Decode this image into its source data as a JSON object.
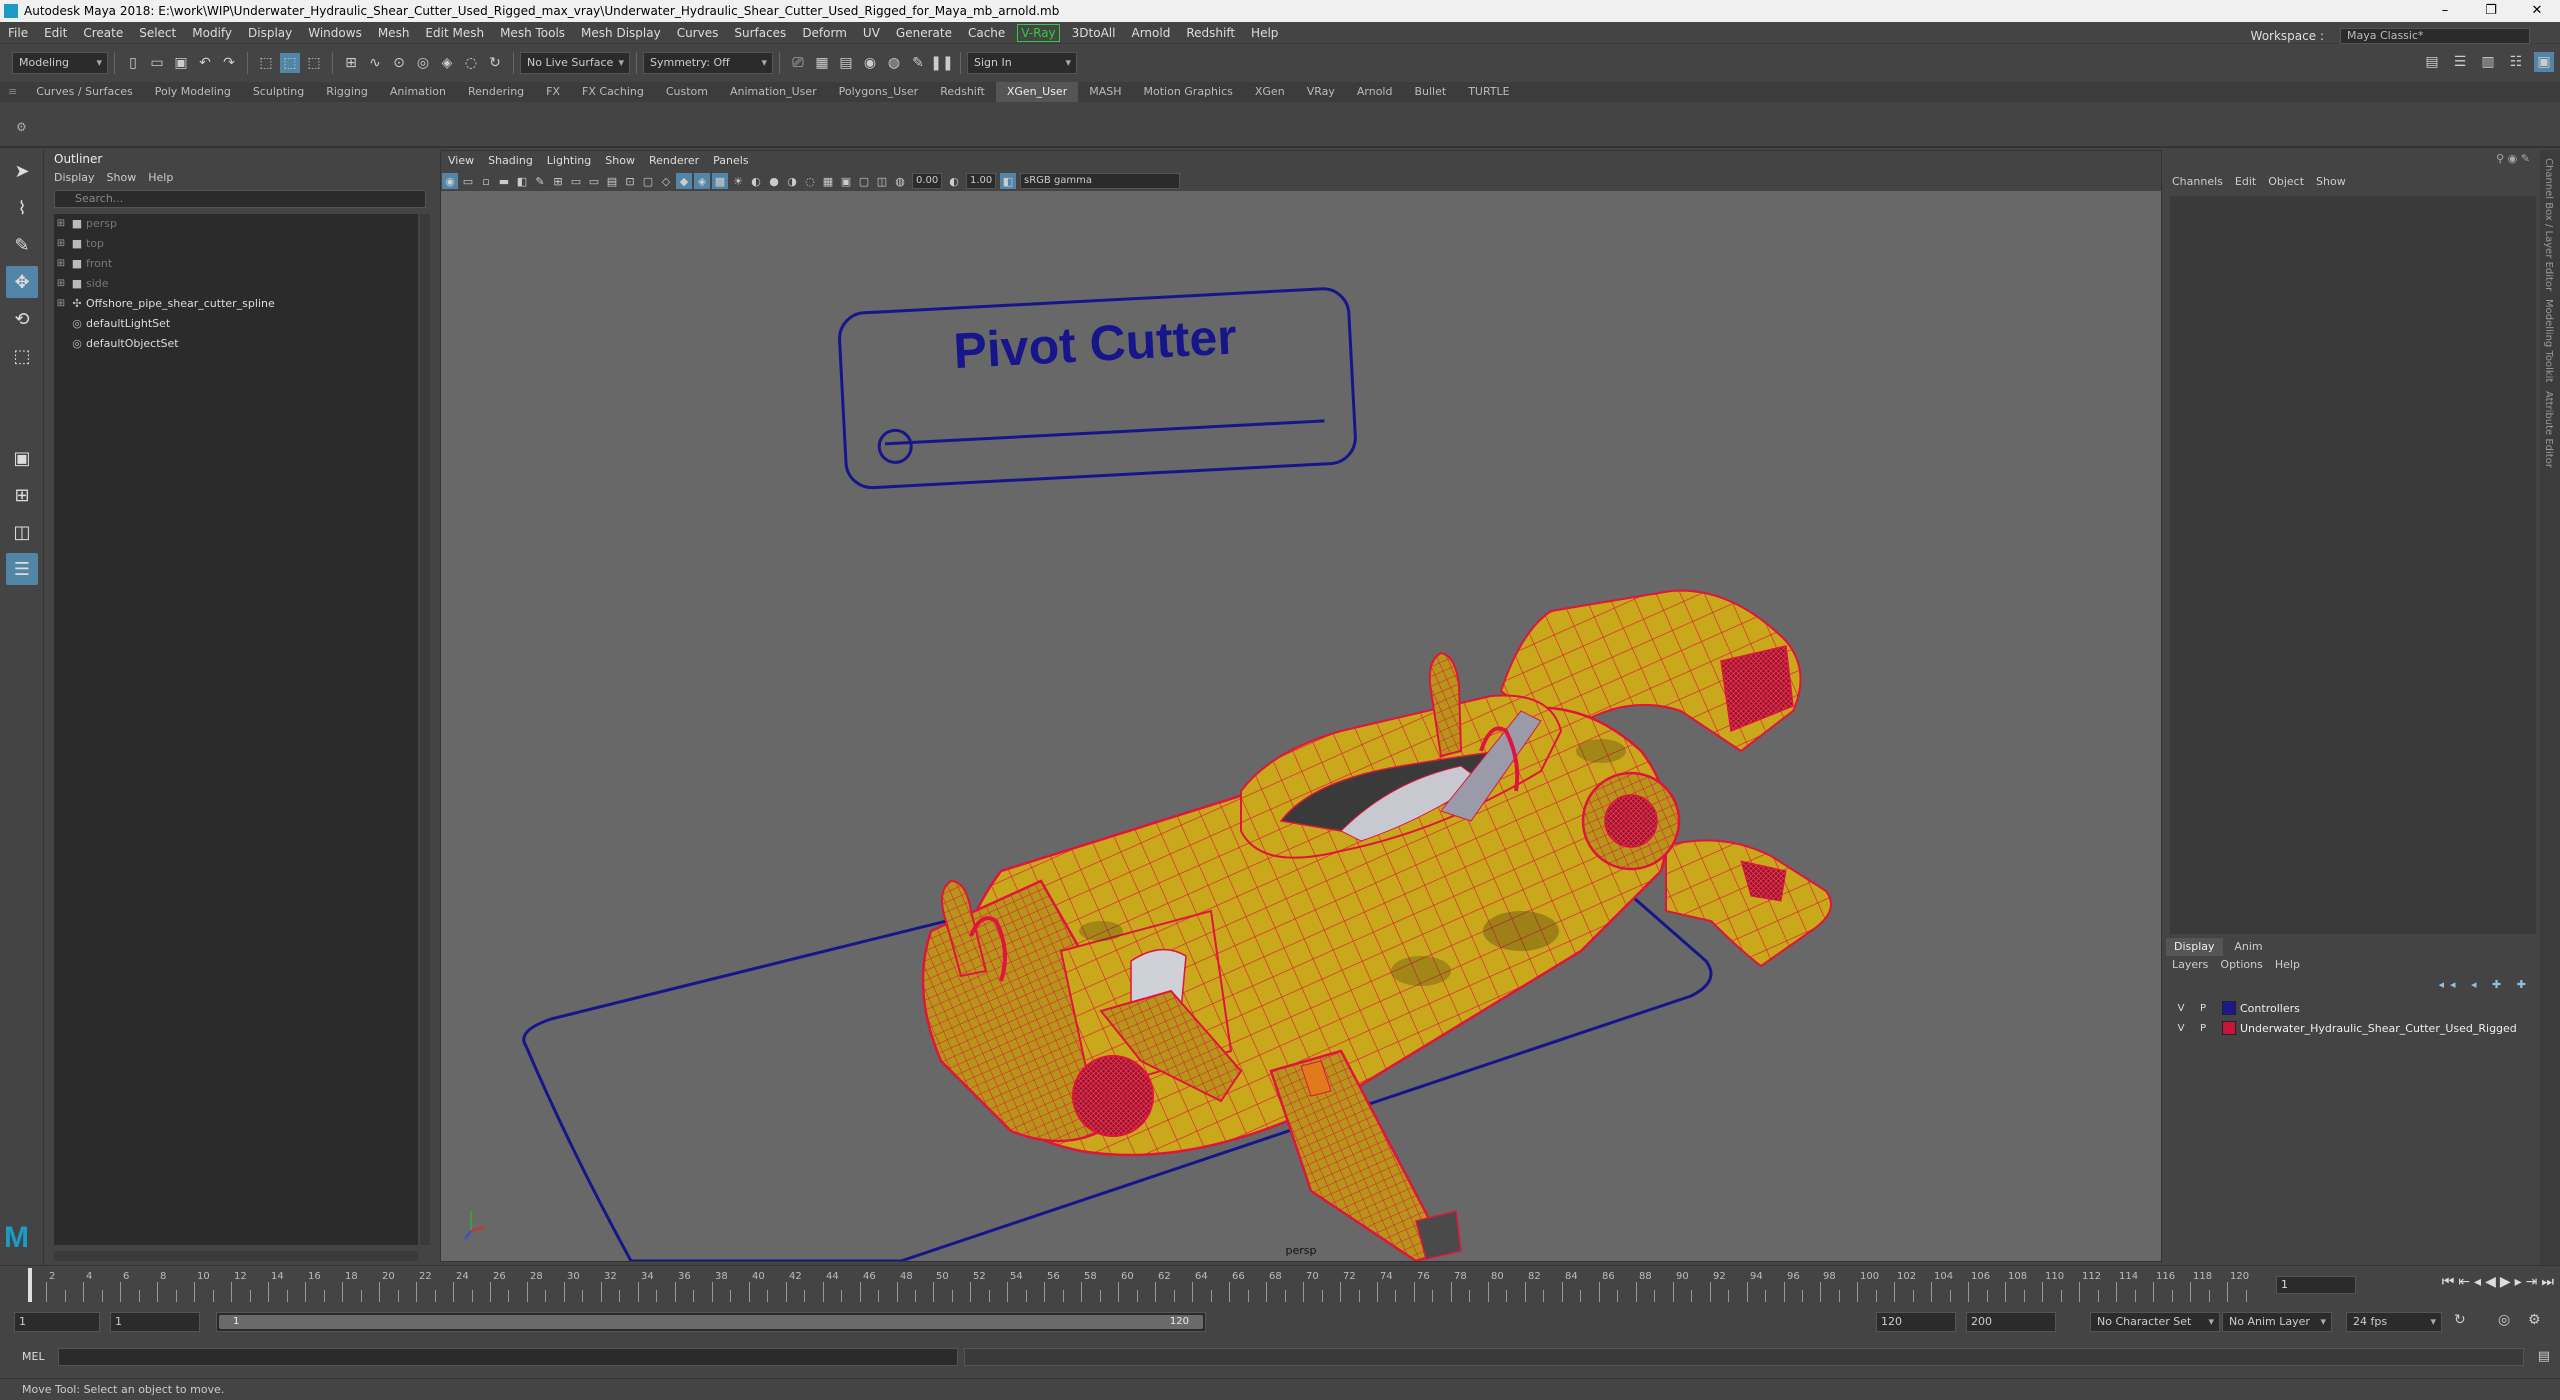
{
  "app": {
    "title": "Autodesk Maya 2018: E:\\work\\WIP\\Underwater_Hydraulic_Shear_Cutter_Used_Rigged_max_vray\\Underwater_Hydraulic_Shear_Cutter_Used_Rigged_for_Maya_mb_arnold.mb",
    "window_controls": [
      "–",
      "❐",
      "✕"
    ]
  },
  "menubar": {
    "items": [
      "File",
      "Edit",
      "Create",
      "Select",
      "Modify",
      "Display",
      "Windows",
      "Mesh",
      "Edit Mesh",
      "Mesh Tools",
      "Mesh Display",
      "Curves",
      "Surfaces",
      "Deform",
      "UV",
      "Generate",
      "Cache"
    ],
    "vray": "V-Ray",
    "items_after": [
      "3DtoAll",
      "Arnold",
      "Redshift",
      "Help"
    ],
    "workspace_label": "Workspace :",
    "workspace_value": "Maya Classic*"
  },
  "statusline": {
    "mode": "Modeling",
    "live_surface": "No Live Surface",
    "symmetry": "Symmetry: Off",
    "sign_in": "Sign In"
  },
  "shelf": {
    "tabs": [
      "Curves / Surfaces",
      "Poly Modeling",
      "Sculpting",
      "Rigging",
      "Animation",
      "Rendering",
      "FX",
      "FX Caching",
      "Custom",
      "Animation_User",
      "Polygons_User",
      "Redshift",
      "XGen_User",
      "MASH",
      "Motion Graphics",
      "XGen",
      "VRay",
      "Arnold",
      "Bullet",
      "TURTLE"
    ],
    "active": "XGen_User"
  },
  "outliner": {
    "title": "Outliner",
    "menu": [
      "Display",
      "Show",
      "Help"
    ],
    "search_placeholder": "Search...",
    "items": [
      {
        "label": "persp",
        "dim": true
      },
      {
        "label": "top",
        "dim": true
      },
      {
        "label": "front",
        "dim": true
      },
      {
        "label": "side",
        "dim": true
      },
      {
        "label": "Offshore_pipe_shear_cutter_spline",
        "dim": false
      },
      {
        "label": "defaultLightSet",
        "dim": false
      },
      {
        "label": "defaultObjectSet",
        "dim": false
      }
    ]
  },
  "viewport": {
    "menu": [
      "View",
      "Shading",
      "Lighting",
      "Show",
      "Renderer",
      "Panels"
    ],
    "exposure": "0.00",
    "gamma": "1.00",
    "color_space": "sRGB gamma",
    "camera": "persp",
    "controller_text": "Pivot Cutter"
  },
  "channelbox": {
    "menu": [
      "Channels",
      "Edit",
      "Object",
      "Show"
    ]
  },
  "layer_editor": {
    "tabs": [
      "Display",
      "Anim"
    ],
    "menu": [
      "Layers",
      "Options",
      "Help"
    ],
    "layers": [
      {
        "v": "V",
        "p": "P",
        "name": "Controllers",
        "color": "#1a1a8c"
      },
      {
        "v": "V",
        "p": "P",
        "name": "Underwater_Hydraulic_Shear_Cutter_Used_Rigged",
        "color": "#c8143c"
      }
    ]
  },
  "side_tabs": [
    "Channel Box / Layer Editor",
    "Modelling Toolkit",
    "Attribute Editor"
  ],
  "timeline": {
    "ticks": [
      "2",
      "4",
      "6",
      "8",
      "10",
      "12",
      "14",
      "16",
      "18",
      "20",
      "22",
      "24",
      "26",
      "28",
      "30",
      "32",
      "34",
      "36",
      "38",
      "40",
      "42",
      "44",
      "46",
      "48",
      "50",
      "52",
      "54",
      "56",
      "58",
      "60",
      "62",
      "64",
      "66",
      "68",
      "70",
      "72",
      "74",
      "76",
      "78",
      "80",
      "82",
      "84",
      "86",
      "88",
      "90",
      "92",
      "94",
      "96",
      "98",
      "100",
      "102",
      "104",
      "106",
      "108",
      "110",
      "112",
      "114",
      "116",
      "118",
      "120"
    ],
    "current_frame": "1"
  },
  "range": {
    "start": "1",
    "anim_start": "1",
    "slider_start": "1",
    "slider_end": "120",
    "end": "120",
    "anim_end": "200",
    "character": "No Character Set",
    "anim_layer": "No Anim Layer",
    "fps": "24 fps"
  },
  "cmdline": {
    "label": "MEL"
  },
  "helpline": {
    "text": "Move Tool: Select an object to move."
  },
  "colors": {
    "accent": "#5285a6",
    "wire_red": "#e0143c",
    "mesh_yellow": "#c9a81c",
    "controller_blue": "#16168a",
    "viewport_bg": "#686868"
  }
}
